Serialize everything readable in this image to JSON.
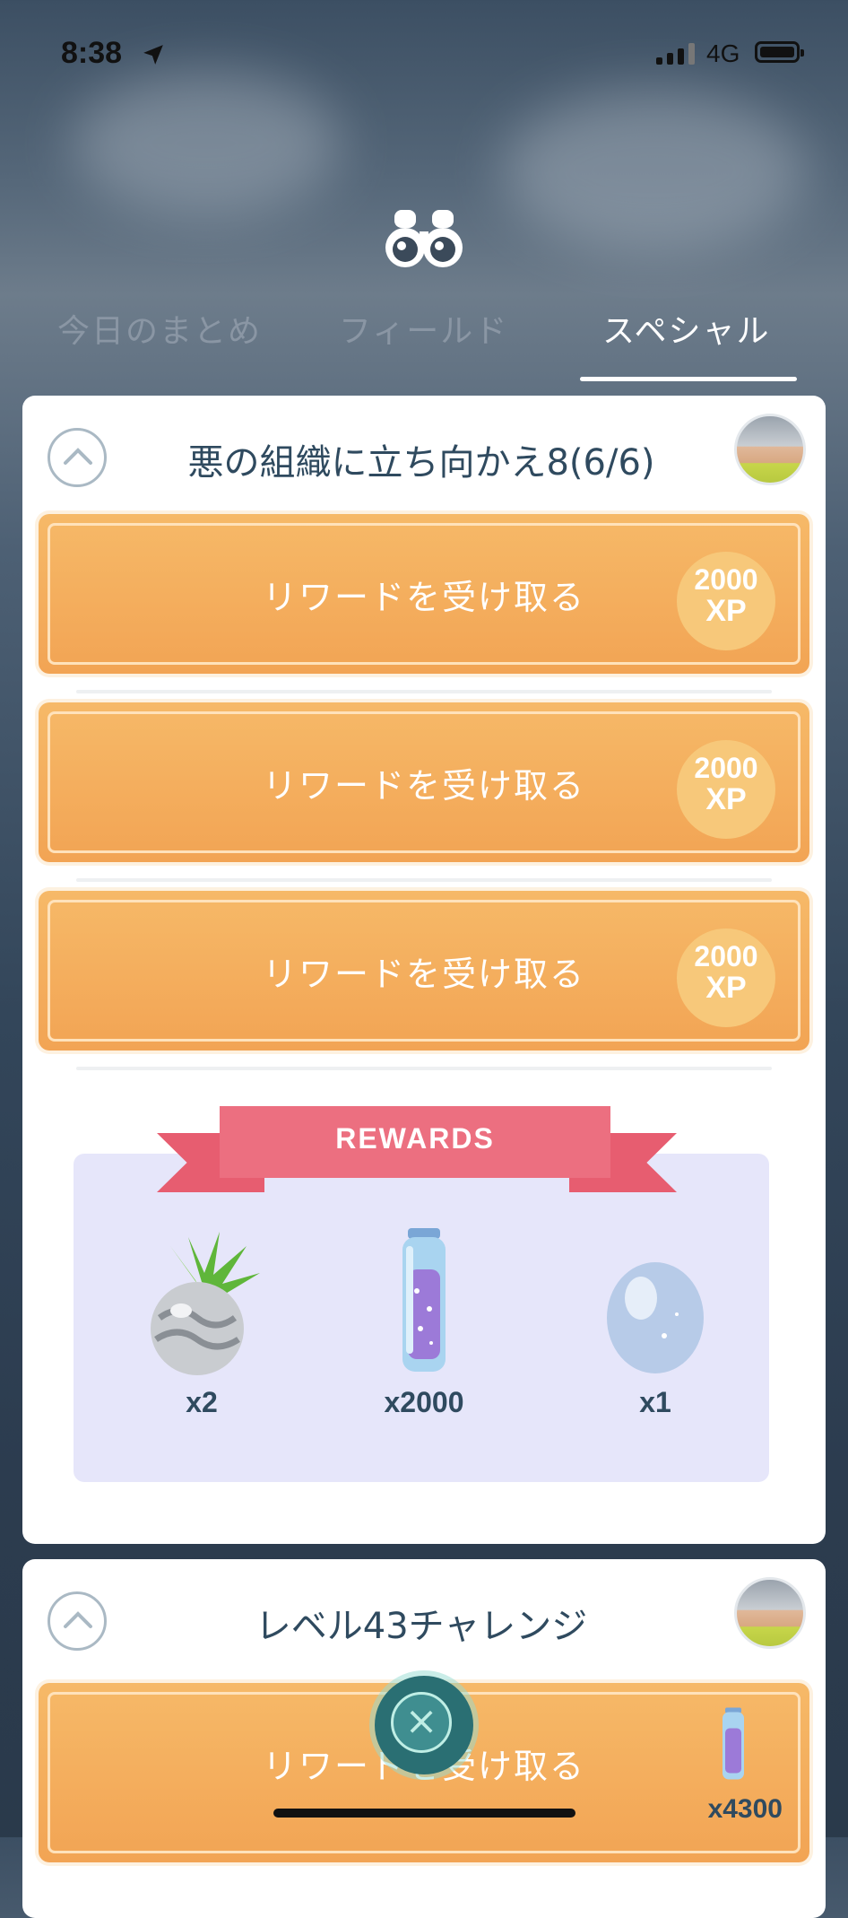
{
  "status": {
    "time": "8:38",
    "network": "4G"
  },
  "tabs": [
    {
      "label": "今日のまとめ"
    },
    {
      "label": "フィールド"
    },
    {
      "label": "スペシャル"
    }
  ],
  "research1": {
    "title": "悪の組織に立ち向かえ8(6/6)",
    "rewards": [
      {
        "label": "リワードを受け取る",
        "xp_value": "2000",
        "xp_unit": "XP"
      },
      {
        "label": "リワードを受け取る",
        "xp_value": "2000",
        "xp_unit": "XP"
      },
      {
        "label": "リワードを受け取る",
        "xp_value": "2000",
        "xp_unit": "XP"
      }
    ],
    "rewards_header": "REWARDS",
    "items": [
      {
        "icon": "silver-pinap-berry-icon",
        "qty": "x2"
      },
      {
        "icon": "stardust-icon",
        "qty": "x2000"
      },
      {
        "icon": "egg-icon",
        "qty": "x1"
      }
    ]
  },
  "research2": {
    "title": "レベル43チャレンジ",
    "reward": {
      "label": "リワードを受け取る",
      "qty": "x4300",
      "icon": "stardust-icon"
    }
  },
  "colors": {
    "accent_orange": "#f2a454",
    "ribbon_pink": "#ec6f80",
    "panel_lavender": "#e6e6fa",
    "title_text": "#2f4a5f"
  }
}
